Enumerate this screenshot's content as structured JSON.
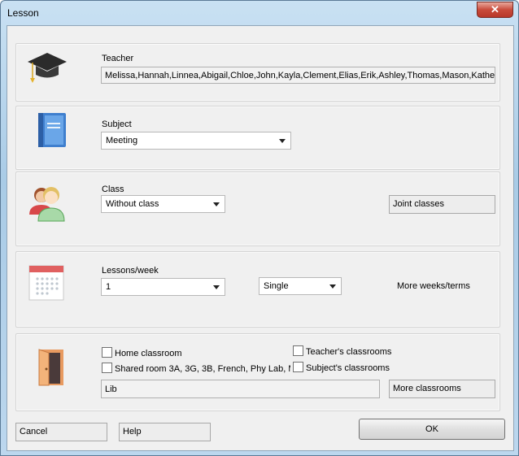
{
  "window": {
    "title": "Lesson",
    "close_glyph": "✕"
  },
  "teacher": {
    "label": "Teacher",
    "value": "Melissa,Hannah,Linnea,Abigail,Chloe,John,Kayla,Clement,Elias,Erik,Ashley,Thomas,Mason,Katherine",
    "icon": "graduation-cap-icon"
  },
  "subject": {
    "label": "Subject",
    "selected": "Meeting",
    "icon": "book-icon"
  },
  "class": {
    "label": "Class",
    "selected": "Without class",
    "joint_label": "Joint classes",
    "icon": "people-icon"
  },
  "lessons": {
    "label": "Lessons/week",
    "count": "1",
    "length": "Single",
    "more_label": "More weeks/terms",
    "icon": "calendar-icon"
  },
  "rooms": {
    "home_label": "Home classroom",
    "shared_label": "Shared room 3A, 3G, 3B, French, Phy Lab, M",
    "teachers_label": "Teacher's classrooms",
    "subjects_label": "Subject's classrooms",
    "value": "Lib",
    "more_label": "More classrooms",
    "icon": "door-icon"
  },
  "footer": {
    "cancel_label": "Cancel",
    "help_label": "Help",
    "ok_label": "OK"
  },
  "colors": {
    "title_bar": "#bcd7ee",
    "close_button": "#c94b3b",
    "dialog_bg": "#f0f0f0"
  }
}
